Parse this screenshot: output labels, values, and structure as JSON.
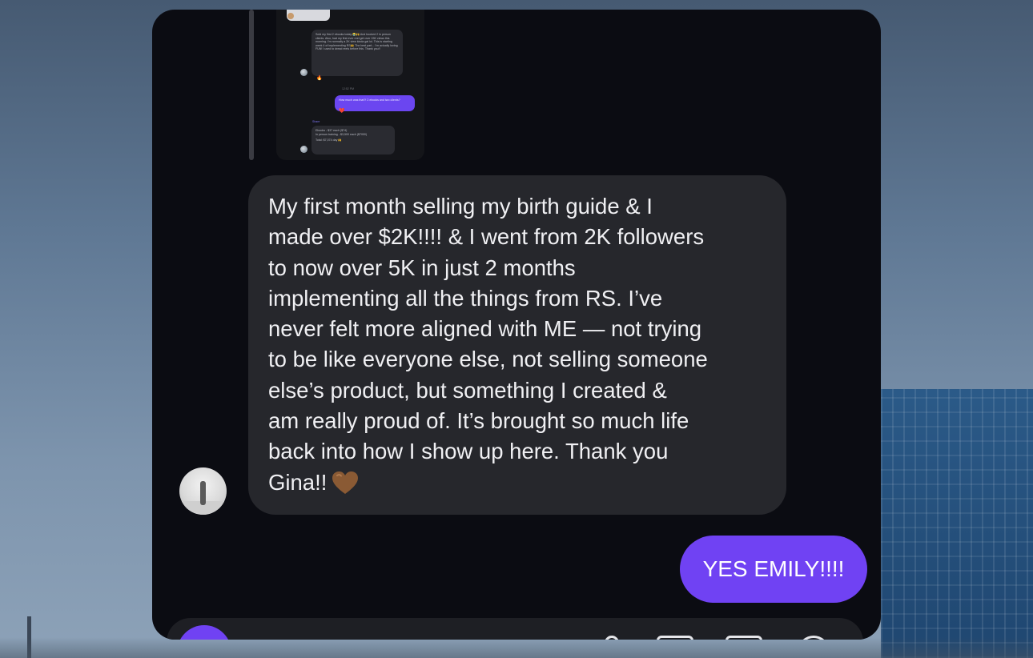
{
  "shared_screenshot": {
    "incoming_message_1": "Sold my first 2 ebooks today 😭🙌 And booked 2 in person clients. Also, had my first ever reel get over 15K views this morning. I'm normally a 2K view kinda gal lol. This is starting week 4 of implementing RS🙌 The best part... I'm actually loving FUN! I used to dread reels before this. Thank you!!",
    "reaction_1": "🔥",
    "timestamp": "12:52 PM",
    "outgoing_message": "How much was that?! 2 ebooks and two clients?",
    "reaction_2": "❤️",
    "reply_label": "Share",
    "incoming_message_2_line_1": "Ebooks - $37 each ($74)",
    "incoming_message_2_line_2": "In person training - $3,500 each ($7000)",
    "incoming_message_2_line_3": "Total: $7,074 day 🙌"
  },
  "received_message": {
    "text": "My first month selling my birth guide & I\nmade over $2K!!!! & I went from 2K followers\nto now over 5K in just 2 months\nimplementing all the things from RS. I’ve\nnever felt more aligned with ME — not trying\nto be like everyone else, not selling someone\nelse’s product, but something I created &\nam really proud of. It’s brought so much life\nback into how I show up here. Thank you\nGina!!",
    "emoji": "brown-heart"
  },
  "sent_message": {
    "text": "YES EMILY!!!!"
  },
  "colors": {
    "accent": "#7042f3",
    "received_bubble": "#26272c",
    "chat_background": "#0b0c12",
    "heart": "#8a5a34"
  }
}
